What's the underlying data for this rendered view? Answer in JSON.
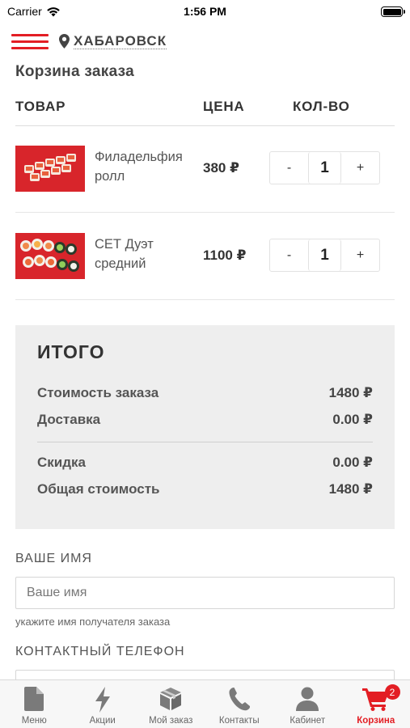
{
  "status_bar": {
    "carrier": "Carrier",
    "time": "1:56 PM"
  },
  "header": {
    "city": "ХАБАРОВСК"
  },
  "cart": {
    "title": "Корзина заказа",
    "columns": {
      "product": "ТОВАР",
      "price": "ЦЕНА",
      "qty": "КОЛ-ВО"
    },
    "items": [
      {
        "name": "Филадельфия ролл",
        "price": "380 ₽",
        "qty": "1",
        "minus": "-",
        "plus": "+"
      },
      {
        "name": "СЕТ Дуэт средний",
        "price": "1100 ₽",
        "qty": "1",
        "minus": "-",
        "plus": "+"
      }
    ]
  },
  "summary": {
    "title": "ИТОГО",
    "rows": [
      {
        "label": "Стоимость заказа",
        "value": "1480 ₽"
      },
      {
        "label": "Доставка",
        "value": "0.00 ₽"
      },
      {
        "label": "Скидка",
        "value": "0.00 ₽"
      },
      {
        "label": "Общая стоимость",
        "value": "1480 ₽"
      }
    ]
  },
  "form": {
    "name_label": "ВАШЕ ИМЯ",
    "name_placeholder": "Ваше имя",
    "name_hint": "укажите имя получателя заказа",
    "phone_label": "КОНТАКТНЫЙ ТЕЛЕФОН"
  },
  "tab_bar": {
    "accent_color": "#e31e24",
    "tabs": [
      {
        "label": "Меню",
        "icon": "document-icon"
      },
      {
        "label": "Акции",
        "icon": "lightning-icon"
      },
      {
        "label": "Мой заказ",
        "icon": "box-icon"
      },
      {
        "label": "Контакты",
        "icon": "phone-icon"
      },
      {
        "label": "Кабинет",
        "icon": "user-icon"
      },
      {
        "label": "Корзина",
        "icon": "cart-icon",
        "badge": "2",
        "active": true
      }
    ]
  }
}
